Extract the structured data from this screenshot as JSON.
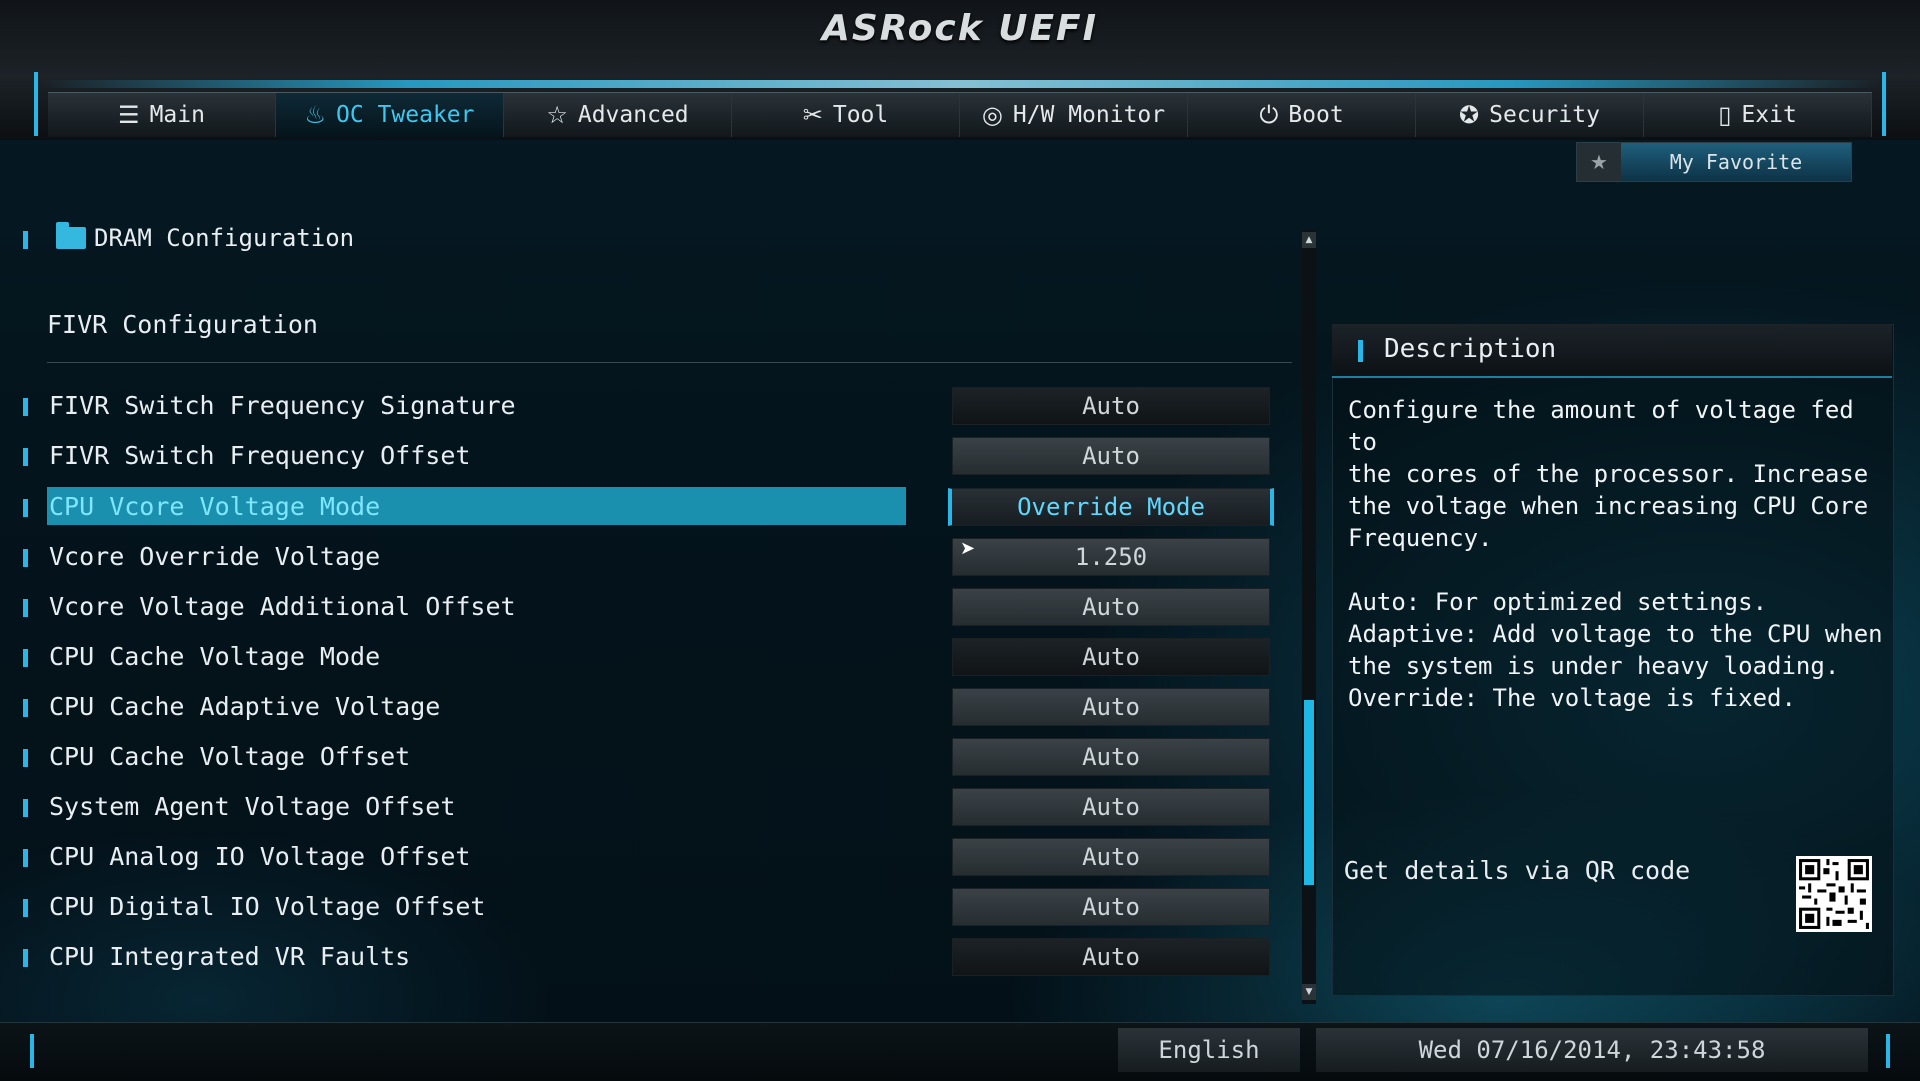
{
  "header": {
    "logo": "ASRock UEFI"
  },
  "nav": {
    "tabs": [
      {
        "label": "Main",
        "icon": "☰"
      },
      {
        "label": "OC Tweaker",
        "icon": "♨"
      },
      {
        "label": "Advanced",
        "icon": "☆"
      },
      {
        "label": "Tool",
        "icon": "✂"
      },
      {
        "label": "H/W Monitor",
        "icon": "◎"
      },
      {
        "label": "Boot",
        "icon": "⏻"
      },
      {
        "label": "Security",
        "icon": "✪"
      },
      {
        "label": "Exit",
        "icon": "▯"
      }
    ],
    "active_index": 1,
    "accent_color": "#2ab6e6"
  },
  "favorite": {
    "star": "★",
    "label": "My Favorite"
  },
  "breadcrumb": {
    "label": "DRAM Configuration"
  },
  "section": {
    "title": "FIVR Configuration"
  },
  "settings": [
    {
      "label": "FIVR Switch Frequency Signature",
      "value": "Auto"
    },
    {
      "label": "FIVR Switch Frequency Offset",
      "value": "Auto"
    },
    {
      "label": "CPU Vcore Voltage Mode",
      "value": "Override Mode"
    },
    {
      "label": "Vcore Override Voltage",
      "value": "1.250"
    },
    {
      "label": "Vcore Voltage Additional Offset",
      "value": "Auto"
    },
    {
      "label": "CPU Cache Voltage Mode",
      "value": "Auto"
    },
    {
      "label": "CPU Cache Adaptive Voltage",
      "value": "Auto"
    },
    {
      "label": "CPU Cache Voltage Offset",
      "value": "Auto"
    },
    {
      "label": "System Agent Voltage Offset",
      "value": "Auto"
    },
    {
      "label": "CPU Analog IO Voltage Offset",
      "value": "Auto"
    },
    {
      "label": "CPU Digital IO Voltage Offset",
      "value": "Auto"
    },
    {
      "label": "CPU Integrated VR Faults",
      "value": "Auto"
    }
  ],
  "selected_index": 2,
  "description": {
    "title": "Description",
    "paragraph1": "Configure the amount of voltage fed to\nthe cores of the processor. Increase\nthe voltage when increasing CPU Core\nFrequency.",
    "paragraph2": "Auto: For optimized settings.\nAdaptive: Add voltage to the CPU when\nthe system is under heavy loading.\nOverride: The voltage is fixed.",
    "qr_label": "Get details via QR code"
  },
  "footer": {
    "language": "English",
    "datetime": "Wed 07/16/2014, 23:43:58"
  }
}
